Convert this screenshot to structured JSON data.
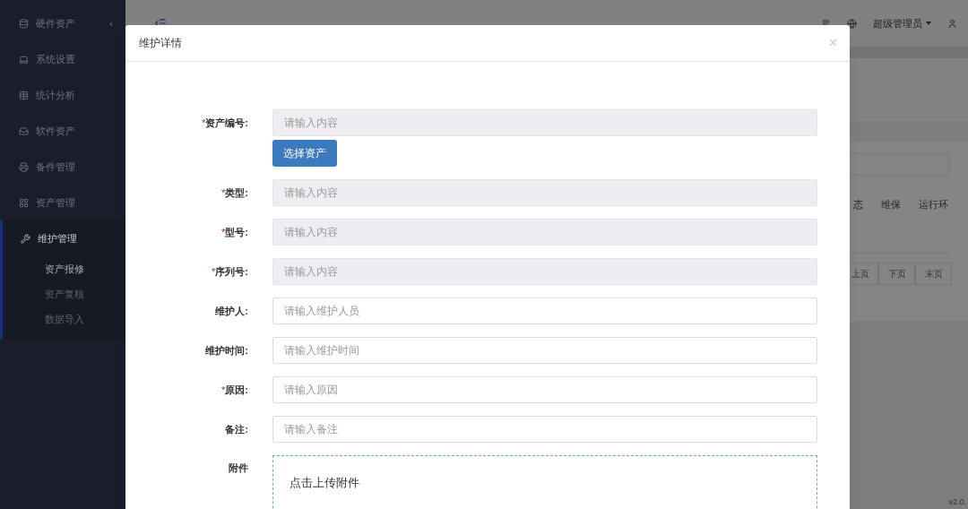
{
  "sidebar": {
    "items": [
      {
        "label": "硬件资产",
        "collapse_mark": "‹",
        "expanded": false
      },
      {
        "label": "系统设置",
        "expanded": false
      },
      {
        "label": "统计分析",
        "expanded": false
      },
      {
        "label": "软件资产",
        "expanded": false
      },
      {
        "label": "备件管理",
        "expanded": false
      },
      {
        "label": "资产管理",
        "expanded": false
      },
      {
        "label": "维护管理",
        "expanded": true,
        "children": [
          {
            "label": "资产报修",
            "selected": true
          },
          {
            "label": "资产复核",
            "selected": false
          },
          {
            "label": "数据导入",
            "selected": false
          }
        ]
      }
    ]
  },
  "header": {
    "user": "超级管理员"
  },
  "background": {
    "table_columns": [
      "态",
      "维保",
      "运行环"
    ],
    "pagination": [
      "上页",
      "下页",
      "末页"
    ],
    "version": "v2.0."
  },
  "modal": {
    "title": "维护详情",
    "close": "×",
    "fields": [
      {
        "required_mark": "*",
        "label": "资产编号:",
        "placeholder": "请输入内容",
        "disabled": true,
        "button": "选择资产"
      },
      {
        "required_mark": "*",
        "label": "类型:",
        "placeholder": "请输入内容",
        "disabled": true
      },
      {
        "required_mark": "*",
        "label": "型号:",
        "placeholder": "请输入内容",
        "disabled": true
      },
      {
        "required_mark": "*",
        "label": "序列号:",
        "placeholder": "请输入内容",
        "disabled": true
      },
      {
        "label": "维护人:",
        "placeholder": "请输入维护人员",
        "disabled": false
      },
      {
        "label": "维护时间:",
        "placeholder": "请输入维护时间",
        "disabled": false
      },
      {
        "required_mark": "*",
        "label": "原因:",
        "placeholder": "请输入原因",
        "disabled": false
      },
      {
        "label": "备注:",
        "placeholder": "请输入备注",
        "disabled": false
      }
    ],
    "attachment": {
      "label": "附件",
      "prompt": "点击上传附件"
    }
  }
}
